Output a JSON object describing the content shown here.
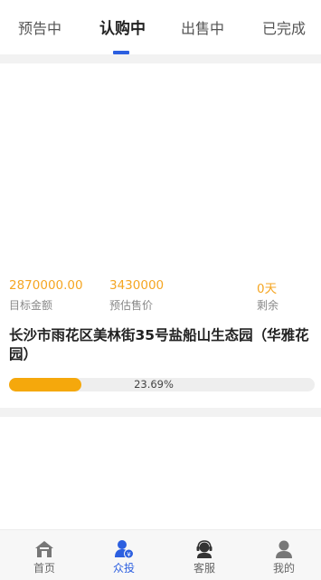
{
  "tabs": [
    {
      "label": "预告中"
    },
    {
      "label": "认购中"
    },
    {
      "label": "出售中"
    },
    {
      "label": "已完成"
    }
  ],
  "active_tab": "认购中",
  "listing": {
    "stats": [
      {
        "value": "2870000.00",
        "label": "目标金额"
      },
      {
        "value": "3430000",
        "label": "预估售价"
      },
      {
        "value": "0天",
        "label": "剩余"
      }
    ],
    "title": "长沙市雨花区美林街35号盐船山生态园（华雅花园）",
    "progress": {
      "percent": 23.69,
      "label": "23.69%"
    }
  },
  "bottom_nav": [
    {
      "label": "首页",
      "icon": "home-icon"
    },
    {
      "label": "众投",
      "icon": "crowdfund-user-icon"
    },
    {
      "label": "客服",
      "icon": "customer-service-icon"
    },
    {
      "label": "我的",
      "icon": "profile-icon"
    }
  ],
  "colors": {
    "accent": "#2c5fe0",
    "stat_value": "#f5a623",
    "progress_fill": "#f5a80c"
  }
}
